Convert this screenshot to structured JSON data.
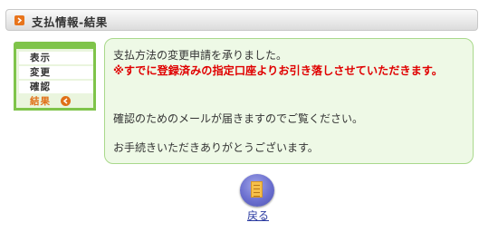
{
  "header": {
    "title": "支払情報-結果",
    "icon": "chevron-right-icon"
  },
  "steps": {
    "items": [
      "表示",
      "変更",
      "確認",
      "結果"
    ],
    "active_index": 3,
    "active_icon": "arrow-circle-icon",
    "colors": {
      "frame": "#7fc44a",
      "active_text": "#e07018"
    }
  },
  "message": {
    "line1": "支払方法の変更申請を承りました。",
    "warning": "※すでに登録済みの指定口座よりお引き落しさせていただきます。",
    "line3": "確認のためのメールが届きますのでご覧ください。",
    "line4": "お手続きいただきありがとうございます。",
    "colors": {
      "warning": "#e00000",
      "background": "#eef9e6",
      "border": "#a9d98b"
    }
  },
  "back": {
    "label": "戻る",
    "icon": "document-icon"
  }
}
